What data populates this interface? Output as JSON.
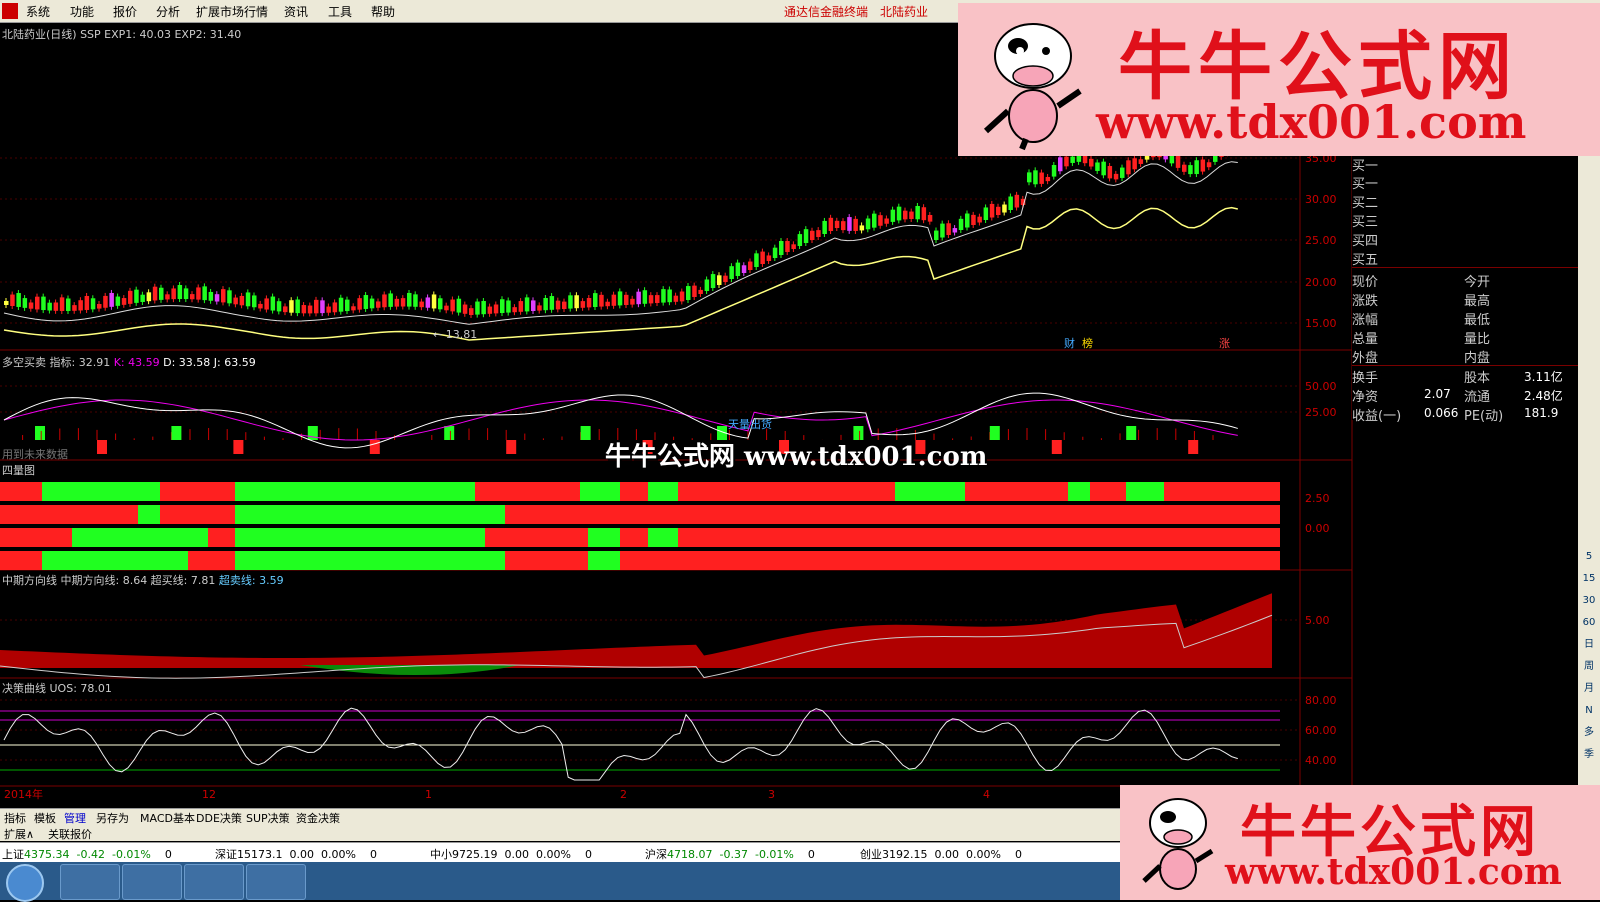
{
  "menu": {
    "items": [
      "系统",
      "功能",
      "报价",
      "分析",
      "扩展市场行情",
      "资讯",
      "工具",
      "帮助"
    ],
    "brand": "通达信金融终端",
    "stock": "北陆药业"
  },
  "panes": {
    "main": {
      "label": "北陆药业(日线) SSP  EXP1: 40.03  EXP2: 31.40",
      "low_mark": "← 13.81",
      "tags": [
        "财",
        "榜",
        "涨"
      ]
    },
    "kdj": {
      "label": "多空买卖  指标: 32.91",
      "k": "K: 43.59",
      "dj": "D: 33.58  J: 63.59",
      "foot": "用到未来数据",
      "note": "天量出货"
    },
    "four": {
      "label": "四量图"
    },
    "trend": {
      "label": "中期方向线  中期方向线: 8.64  超买线: 7.81",
      "oversell": "超卖线: 3.59"
    },
    "uos": {
      "label": "决策曲线  UOS: 78.01"
    }
  },
  "axes": {
    "main": [
      "35.00",
      "30.00",
      "25.00",
      "20.00",
      "15.00"
    ],
    "kdj": [
      "50.00",
      "25.00"
    ],
    "four": [
      "2.50",
      "0.00"
    ],
    "trend": [
      "5.00"
    ],
    "uos": [
      "80.00",
      "60.00",
      "40.00"
    ],
    "dates": [
      "2014年",
      "12",
      "1",
      "2",
      "3",
      "4"
    ]
  },
  "quote_panel": {
    "orders": [
      "买一",
      "买一",
      "买二",
      "买三",
      "买四",
      "买五"
    ],
    "rows_left": [
      "现价",
      "涨跌",
      "涨幅",
      "总量",
      "外盘"
    ],
    "rows_right": [
      "今开",
      "最高",
      "最低",
      "量比",
      "内盘"
    ],
    "stats": [
      {
        "label": "换手",
        "v1": "",
        "label2": "股本",
        "v2": "3.11亿"
      },
      {
        "label": "净资",
        "v1": "2.07",
        "label2": "流通",
        "v2": "2.48亿"
      },
      {
        "label": "收益(一)",
        "v1": "0.066",
        "label2": "PE(动)",
        "v2": "181.9"
      }
    ]
  },
  "toolstrip": [
    "5",
    "15",
    "30",
    "60",
    "日",
    "周",
    "月",
    "N",
    "多",
    "季"
  ],
  "tabs": [
    "指标",
    "模板",
    "管理",
    "另存为",
    "MACD基本",
    "DDE决策",
    "SUP决策",
    "资金决策"
  ],
  "tabs2": [
    "扩展∧",
    "关联报价"
  ],
  "status": [
    {
      "name": "上证",
      "value": "4375.34",
      "chg": "-0.42",
      "pct": "-0.01%",
      "vol": "0"
    },
    {
      "name": "深证",
      "value": "15173.1",
      "chg": "0.00",
      "pct": "0.00%",
      "vol": "0"
    },
    {
      "name": "中小",
      "value": "9725.19",
      "chg": "0.00",
      "pct": "0.00%",
      "vol": "0"
    },
    {
      "name": "沪深",
      "value": "4718.07",
      "chg": "-0.37",
      "pct": "-0.01%",
      "vol": "0"
    },
    {
      "name": "创业",
      "value": "3192.15",
      "chg": "0.00",
      "pct": "0.00%",
      "vol": "0"
    }
  ],
  "watermark": {
    "title": "牛牛公式网",
    "url": "www.tdx001.com",
    "mid": "牛牛公式网  www.tdx001.com"
  },
  "colors": {
    "up": "#ff2020",
    "down": "#20ff20",
    "bg": "#000000",
    "accent": "#e0101a"
  }
}
